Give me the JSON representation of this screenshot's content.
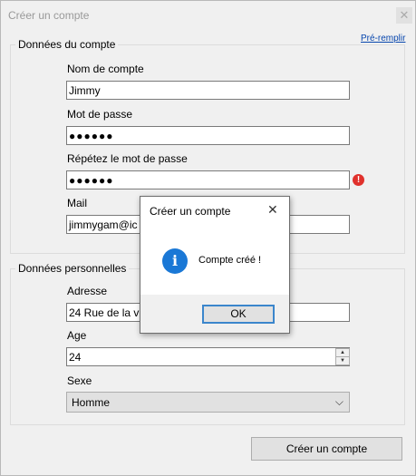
{
  "window": {
    "title": "Créer un compte",
    "close_glyph": "✕"
  },
  "prefill_link": "Pré-remplir",
  "account_group": {
    "legend": "Données du compte",
    "username_label": "Nom de compte",
    "username_value": "Jimmy",
    "password_label": "Mot de passe",
    "password_value": "●●●●●●",
    "repeat_label": "Répétez le mot de passe",
    "repeat_value": "●●●●●●",
    "error_icon_glyph": "!",
    "mail_label": "Mail",
    "mail_value": "jimmygam@ic"
  },
  "personal_group": {
    "legend": "Données personnelles",
    "address_label": "Adresse",
    "address_value": "24 Rue de la vil",
    "age_label": "Age",
    "age_value": "24",
    "spin_up_glyph": "▲",
    "spin_down_glyph": "▼",
    "sex_label": "Sexe",
    "sex_value": "Homme",
    "chevron_glyph": "⌵"
  },
  "create_button": "Créer un compte",
  "dialog": {
    "title": "Créer un compte",
    "close_glyph": "✕",
    "info_glyph": "i",
    "message": "Compte créé !",
    "ok_label": "OK"
  },
  "colors": {
    "window_bg": "#f0f0f0",
    "link": "#0645ad",
    "error": "#e0312c",
    "info": "#1a78d6",
    "default_button_border": "#3b86cc"
  }
}
